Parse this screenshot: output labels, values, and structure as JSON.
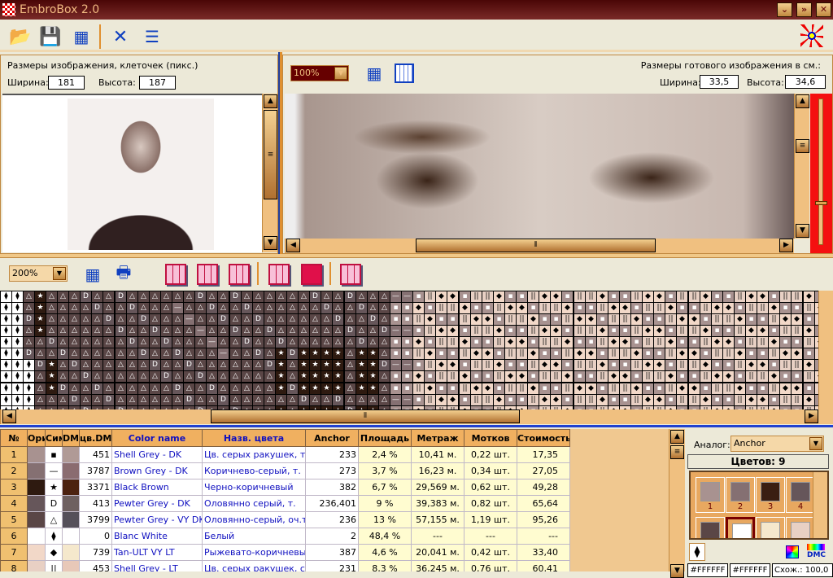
{
  "app": {
    "title": "EmbroBox 2.0"
  },
  "window_buttons": [
    "minimize",
    "maximize",
    "close"
  ],
  "toolbar": {
    "icons": [
      "open-folder-icon",
      "save-icon",
      "table-icon",
      "tools-icon",
      "ruler-icon"
    ]
  },
  "source": {
    "label": "Размеры изображения, клеточек (пикс.)",
    "width_label": "Ширина:",
    "width": "181",
    "height_label": "Высота:",
    "height": "187"
  },
  "preview": {
    "zoom": "100%",
    "label": "Размеры готового изображения в см.:",
    "width_label": "Ширина:",
    "width": "33,5",
    "height_label": "Высота:",
    "height": "34,6",
    "slider_level": 0.3
  },
  "pattern": {
    "zoom": "200%"
  },
  "table": {
    "headers": [
      "№",
      "Ори",
      "Сим",
      "DM",
      "цв.DMC",
      "Color name",
      "Назв. цвета",
      "Anchor",
      "Площадь",
      "Метраж",
      "Мотков",
      "Стоимость"
    ],
    "rows": [
      {
        "n": "1",
        "orig": "#a89290",
        "sym": "▪",
        "dmc_color": "#b09a96",
        "dmc": "451",
        "name": "Shell Grey - DK",
        "ru": "Цв. серых ракушек, т.",
        "anchor": "233",
        "area": "2,4 %",
        "length": "10,41 м.",
        "skeins": "0,22 шт.",
        "cost": "17,35"
      },
      {
        "n": "2",
        "orig": "#857072",
        "sym": "—",
        "dmc_color": "#8a6c70",
        "dmc": "3787",
        "name": "Brown Grey - DK",
        "ru": "Коричнево-серый, т.",
        "anchor": "273",
        "area": "3,7 %",
        "length": "16,23 м.",
        "skeins": "0,34 шт.",
        "cost": "27,05"
      },
      {
        "n": "3",
        "orig": "#2e1a10",
        "sym": "★",
        "dmc_color": "#4c2210",
        "dmc": "3371",
        "name": "Black Brown",
        "ru": "Черно-коричневый",
        "anchor": "382",
        "area": "6,7 %",
        "length": "29,569 м.",
        "skeins": "0,62 шт.",
        "cost": "49,28"
      },
      {
        "n": "4",
        "orig": "#66565a",
        "sym": "D",
        "dmc_color": "#6e6060",
        "dmc": "413",
        "name": "Pewter Grey - DK",
        "ru": "Оловянно серый, т.",
        "anchor": "236,401",
        "area": "9 %",
        "length": "39,383 м.",
        "skeins": "0,82 шт.",
        "cost": "65,64"
      },
      {
        "n": "5",
        "orig": "#5a4646",
        "sym": "△",
        "dmc_color": "#55505a",
        "dmc": "3799",
        "name": "Pewter Grey - VY DK",
        "ru": "Оловянно-серый, оч.т.",
        "anchor": "236",
        "area": "13 %",
        "length": "57,155 м.",
        "skeins": "1,19 шт.",
        "cost": "95,26"
      },
      {
        "n": "6",
        "orig": "#ffffff",
        "sym": "⧫",
        "dmc_color": "#ffffff",
        "dmc": "0",
        "name": "Blanc White",
        "ru": "Белый",
        "anchor": "2",
        "area": "48,4 %",
        "length": "---",
        "skeins": "---",
        "cost": "---"
      },
      {
        "n": "7",
        "orig": "#f2d8c8",
        "sym": "◆",
        "dmc_color": "#f5e8cc",
        "dmc": "739",
        "name": "Tan-ULT VY LT",
        "ru": "Рыжевато-коричневый,",
        "anchor": "387",
        "area": "4,6 %",
        "length": "20,041 м.",
        "skeins": "0,42 шт.",
        "cost": "33,40"
      },
      {
        "n": "8",
        "orig": "#e8d0c4",
        "sym": "||",
        "dmc_color": "#e8c8b8",
        "dmc": "453",
        "name": "Shell Grey - LT",
        "ru": "Цв. серых ракушек, св.",
        "anchor": "231",
        "area": "8,3 %",
        "length": "36,245 м.",
        "skeins": "0,76 шт.",
        "cost": "60,41"
      }
    ]
  },
  "palette": {
    "analog_label": "Аналог:",
    "analog": "Anchor",
    "count_label": "Цветов: 9",
    "swatches": [
      {
        "n": "1",
        "color": "#a89290"
      },
      {
        "n": "2",
        "color": "#857072"
      },
      {
        "n": "3",
        "color": "#3a1e12"
      },
      {
        "n": "4",
        "color": "#66565a"
      },
      {
        "n": "",
        "color": "#5a4646"
      },
      {
        "n": "",
        "color": "#ffffff"
      },
      {
        "n": "",
        "color": "#f5e8cc"
      },
      {
        "n": "",
        "color": "#e8d0c4"
      }
    ],
    "selected_symbol": "⧫",
    "dmc_button": "DMC",
    "status": [
      "#FFFFFF",
      "#FFFFFF",
      "Схож.: 100,0"
    ]
  }
}
